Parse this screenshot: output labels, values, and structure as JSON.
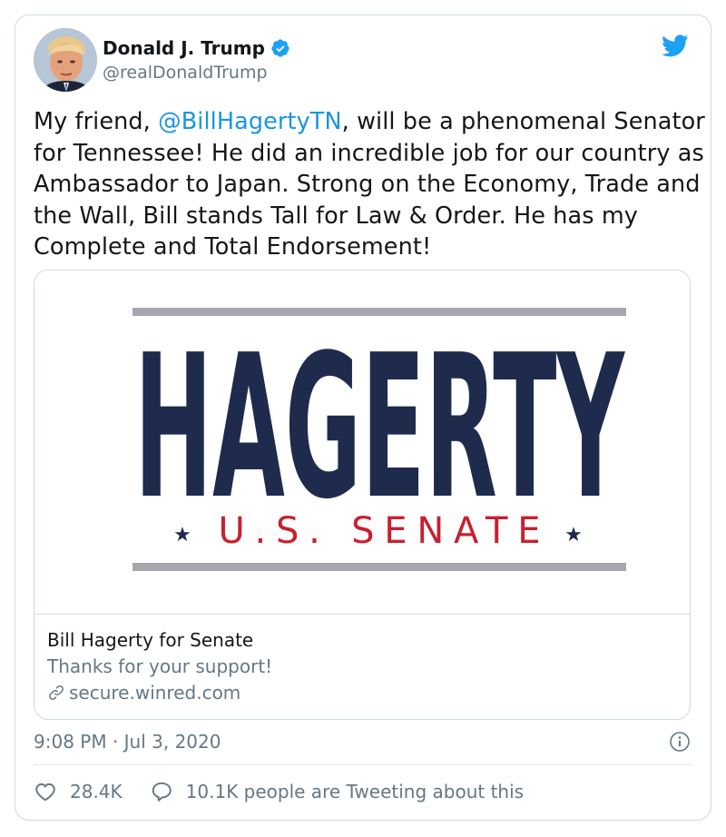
{
  "author": {
    "name": "Donald J. Trump",
    "handle": "@realDonaldTrump",
    "avatar": "avatar-photo",
    "verified_icon": "verified-badge-icon"
  },
  "brand_icon": "twitter-bird-icon",
  "tweet": {
    "text_before": "My friend, ",
    "mention": "@BillHagertyTN",
    "text_after": ", will be a phenomenal Senator for Tennessee! He did an incredible job for our country as Ambassador to Japan. Strong on the Economy, Trade and the Wall, Bill stands Tall for Law & Order. He has my Complete and Total Endorsement!"
  },
  "card": {
    "logo_main": "HAGERTY",
    "logo_sub": "U.S. SENATE",
    "title": "Bill Hagerty for Senate",
    "description": "Thanks for your support!",
    "domain": "secure.winred.com",
    "link_icon": "link-icon"
  },
  "timestamp": "9:08 PM · Jul 3, 2020",
  "info_icon": "info-icon",
  "actions": {
    "likes": "28.4K",
    "reply_text": "10.1K people are Tweeting about this",
    "like_icon": "heart-icon",
    "reply_icon": "reply-icon"
  },
  "colors": {
    "link_blue": "#1b95e0",
    "twitter_blue": "#1da1f2",
    "secondary_text": "#657786",
    "logo_navy": "#1e2b4d",
    "logo_red": "#c8202f",
    "logo_bar_gray": "#a6a8ab"
  }
}
